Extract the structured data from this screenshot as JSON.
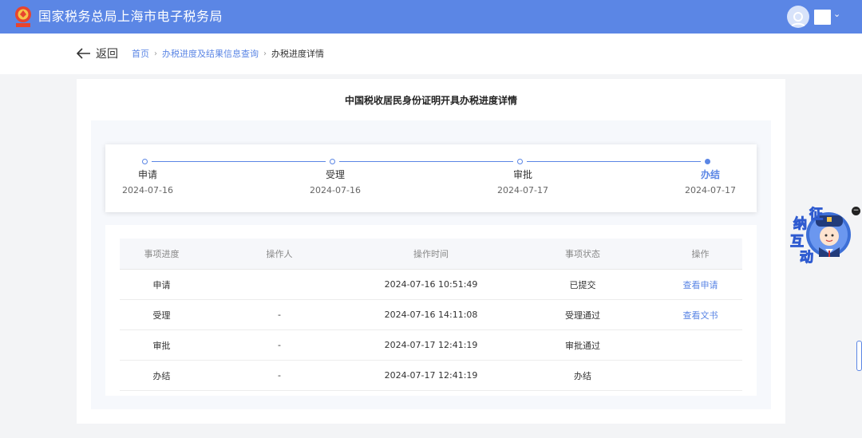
{
  "header": {
    "site_title": "国家税务总局上海市电子税务局",
    "user_menu_chevron": "⌄",
    "brand_color": "#5b86e5"
  },
  "subnav": {
    "back_label": "返回",
    "breadcrumb": {
      "home": "首页",
      "level2": "办税进度及结果信息查询",
      "current": "办税进度详情",
      "separator": "›"
    }
  },
  "page": {
    "title": "中国税收居民身份证明开具办税进度详情"
  },
  "steps": [
    {
      "label": "申请",
      "date": "2024-07-16",
      "state": "done"
    },
    {
      "label": "受理",
      "date": "2024-07-16",
      "state": "done"
    },
    {
      "label": "审批",
      "date": "2024-07-17",
      "state": "done"
    },
    {
      "label": "办结",
      "date": "2024-07-17",
      "state": "current"
    }
  ],
  "table": {
    "headers": [
      "事项进度",
      "操作人",
      "操作时间",
      "事项状态",
      "操作"
    ],
    "rows": [
      {
        "stage": "申请",
        "operator": "",
        "time": "2024-07-16 10:51:49",
        "status": "已提交",
        "action": "查看申请"
      },
      {
        "stage": "受理",
        "operator": "-",
        "time": "2024-07-16 14:11:08",
        "status": "受理通过",
        "action": "查看文书"
      },
      {
        "stage": "审批",
        "operator": "-",
        "time": "2024-07-17 12:41:19",
        "status": "审批通过",
        "action": ""
      },
      {
        "stage": "办结",
        "operator": "-",
        "time": "2024-07-17 12:41:19",
        "status": "办结",
        "action": ""
      }
    ]
  },
  "widget": {
    "chars": [
      "征",
      "纳",
      "互",
      "动"
    ],
    "close_glyph": "−"
  }
}
